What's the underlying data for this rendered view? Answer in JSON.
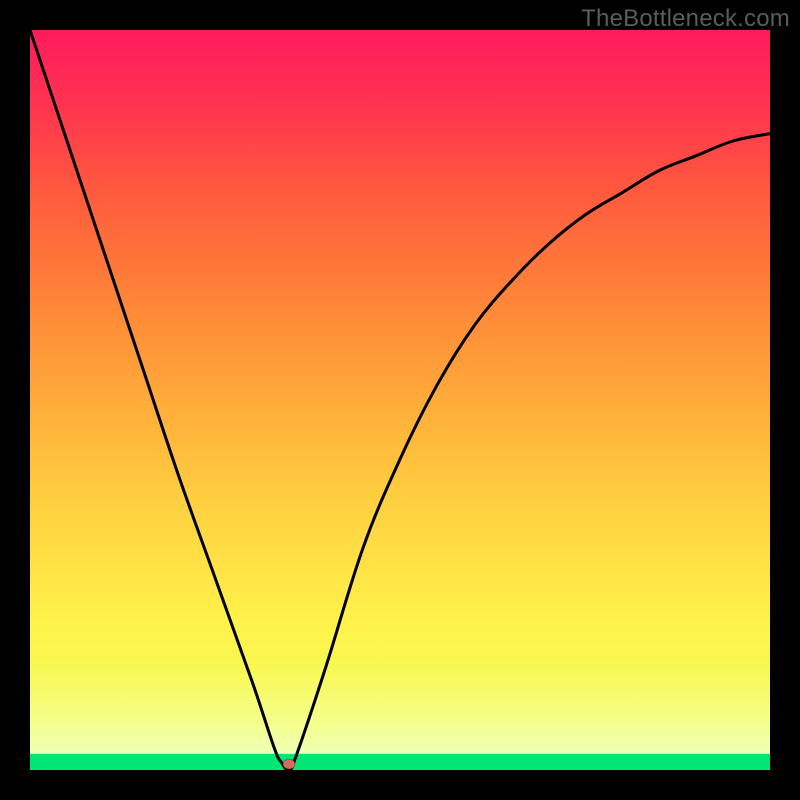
{
  "watermark": "TheBottleneck.com",
  "chart_data": {
    "type": "line",
    "title": "",
    "xlabel": "",
    "ylabel": "",
    "xlim": [
      0,
      100
    ],
    "ylim": [
      0,
      100
    ],
    "grid": false,
    "series": [
      {
        "name": "bottleneck-curve",
        "x": [
          0,
          5,
          10,
          15,
          20,
          25,
          30,
          33,
          34,
          35,
          36,
          40,
          45,
          50,
          55,
          60,
          65,
          70,
          75,
          80,
          85,
          90,
          95,
          100
        ],
        "values": [
          100,
          85,
          70,
          55,
          40,
          26,
          12,
          3,
          1,
          0,
          2,
          14,
          30,
          42,
          52,
          60,
          66,
          71,
          75,
          78,
          81,
          83,
          85,
          86
        ]
      }
    ],
    "marker": {
      "x": 35,
      "y": 0.8,
      "color": "#d96a60",
      "rx": 6,
      "ry": 5
    },
    "background_gradient": {
      "direction": "vertical",
      "stops": [
        {
          "pos": 0.0,
          "color": "#00e676"
        },
        {
          "pos": 0.022,
          "color": "#00e676"
        },
        {
          "pos": 0.06,
          "color": "#f0ff5a"
        },
        {
          "pos": 0.2,
          "color": "#fff24a"
        },
        {
          "pos": 0.36,
          "color": "#ffd040"
        },
        {
          "pos": 0.5,
          "color": "#ffab3a"
        },
        {
          "pos": 0.64,
          "color": "#ff8338"
        },
        {
          "pos": 0.78,
          "color": "#ff5a3e"
        },
        {
          "pos": 0.9,
          "color": "#ff3350"
        },
        {
          "pos": 1.0,
          "color": "#ff1a5c"
        }
      ]
    }
  }
}
